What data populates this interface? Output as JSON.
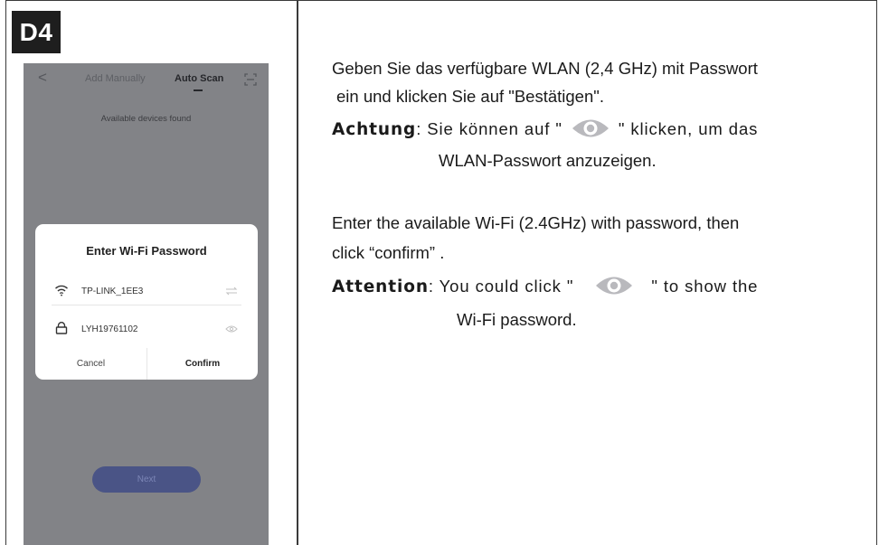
{
  "step": "D4",
  "phone": {
    "tab_manual": "Add Manually",
    "tab_auto": "Auto Scan",
    "found_text": "Available devices found",
    "dialog": {
      "title": "Enter Wi-Fi Password",
      "ssid": "TP-LINK_1EE3",
      "password": "LYH19761102",
      "cancel": "Cancel",
      "confirm": "Confirm"
    },
    "next_label": "Next"
  },
  "german": {
    "line1": "Geben Sie das verfügbare WLAN (2,4 GHz) mit Passwort",
    "line2": "ein und klicken Sie auf \"Bestätigen\".",
    "att_label": "Achtung",
    "att_before": ": Sie können auf \"",
    "att_after": "\" klicken, um das",
    "att_line2": "WLAN-Passwort anzuzeigen."
  },
  "english": {
    "line1": "Enter the available Wi-Fi (2.4GHz) with password, then",
    "line2": "click “confirm” .",
    "att_label": "Attention",
    "att_before": ": You could click \"",
    "att_after": "\" to show the",
    "att_line2": "Wi-Fi password."
  },
  "colors": {
    "phone_bg": "#828387",
    "eye_icon": "#b9b9bd",
    "next_button": "#4a5486"
  }
}
